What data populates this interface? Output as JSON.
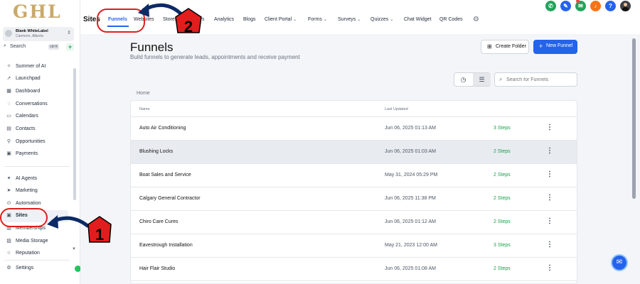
{
  "sidebar": {
    "logo": "GHL",
    "account": {
      "name": "Blank WhiteLabel",
      "location": "Canmore, Alberta"
    },
    "search": {
      "label": "Search",
      "shortcut": "ctrl K"
    },
    "items": [
      {
        "label": "Summer of AI",
        "icon": "sparkle-icon"
      },
      {
        "label": "Launchpad",
        "icon": "rocket-icon"
      },
      {
        "label": "Dashboard",
        "icon": "grid-icon"
      },
      {
        "label": "Conversations",
        "icon": "chat-icon"
      },
      {
        "label": "Calendars",
        "icon": "calendar-icon"
      },
      {
        "label": "Contacts",
        "icon": "contacts-icon"
      },
      {
        "label": "Opportunities",
        "icon": "funnel-icon"
      },
      {
        "label": "Payments",
        "icon": "payments-icon"
      },
      {
        "label": "AI Agents",
        "icon": "ai-icon"
      },
      {
        "label": "Marketing",
        "icon": "send-icon"
      },
      {
        "label": "Automation",
        "icon": "automation-icon"
      },
      {
        "label": "Sites",
        "icon": "sites-icon"
      },
      {
        "label": "Memberships",
        "icon": "memberships-icon"
      },
      {
        "label": "Media Storage",
        "icon": "media-icon"
      },
      {
        "label": "Reputation",
        "icon": "star-icon"
      }
    ],
    "settings": "Settings"
  },
  "topbar": {
    "section_title": "Sites",
    "tabs": [
      {
        "label": "Funnels"
      },
      {
        "label": "Websites"
      },
      {
        "label": "Stores"
      },
      {
        "label": "Webinars"
      },
      {
        "label": "Analytics"
      },
      {
        "label": "Blogs"
      },
      {
        "label": "Client Portal"
      },
      {
        "label": "Forms"
      },
      {
        "label": "Surveys"
      },
      {
        "label": "Quizzes"
      },
      {
        "label": "Chat Widget"
      },
      {
        "label": "QR Codes"
      }
    ],
    "header_icons": [
      {
        "name": "phone-icon",
        "color": "#22a35a"
      },
      {
        "name": "megaphone-icon",
        "color": "#2563eb"
      },
      {
        "name": "chat-icon",
        "color": "#22a35a"
      },
      {
        "name": "bell-icon",
        "color": "#f97316"
      },
      {
        "name": "help-icon",
        "color": "#2563eb"
      }
    ]
  },
  "main": {
    "title": "Funnels",
    "subtitle": "Build funnels to generate leads, appointments and receive payment",
    "create_folder": "Create Folder",
    "new_funnel": "New Funnel",
    "search_placeholder": "Search for Funnels",
    "breadcrumb": "Home",
    "columns": {
      "name": "Name",
      "last_updated": "Last Updated"
    },
    "rows": [
      {
        "name": "Auto Air Conditioning",
        "updated": "Jun 06, 2025 01:13 AM",
        "steps": "3 Steps"
      },
      {
        "name": "Blushing Locks",
        "updated": "Jun 06, 2025 01:03 AM",
        "steps": "2 Steps"
      },
      {
        "name": "Boat Sales and Service",
        "updated": "May 31, 2024 05:29 PM",
        "steps": "2 Steps"
      },
      {
        "name": "Calgary General Contractor",
        "updated": "Jun 06, 2025 11:38 PM",
        "steps": "2 Steps"
      },
      {
        "name": "Chiro Care Cures",
        "updated": "Jun 06, 2025 01:12 AM",
        "steps": "2 Steps"
      },
      {
        "name": "Eavestrough Installation",
        "updated": "May 21, 2023 12:00 AM",
        "steps": "3 Steps"
      },
      {
        "name": "Hair Flair Studio",
        "updated": "Jun 06, 2025 01:08 AM",
        "steps": "2 Steps"
      }
    ]
  },
  "annotations": [
    {
      "number": "1"
    },
    {
      "number": "2"
    }
  ],
  "colors": {
    "accent": "#2563eb",
    "annotation": "#e11d1d",
    "steps": "#16a34a"
  }
}
